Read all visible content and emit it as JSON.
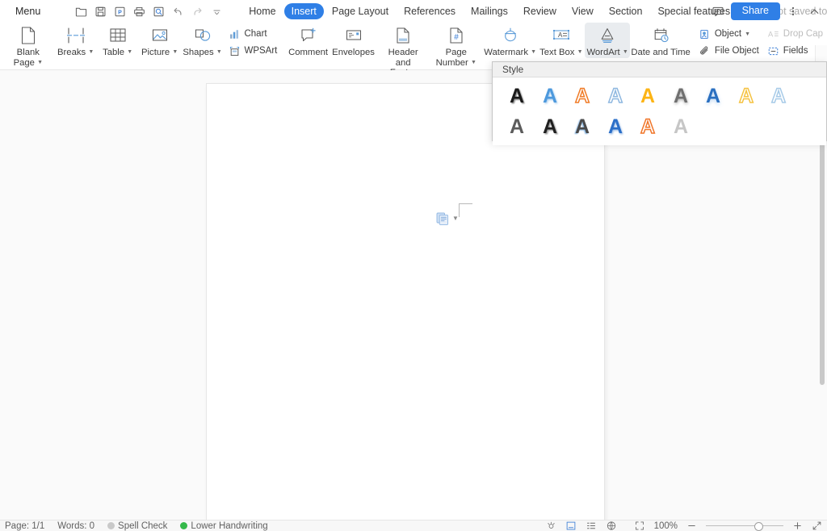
{
  "window": {
    "app": "WPS Writer"
  },
  "topbar": {
    "menu_label": "Menu",
    "quick_access": [
      {
        "name": "open-icon",
        "title": "Open"
      },
      {
        "name": "save-icon",
        "title": "Save"
      },
      {
        "name": "export-pdf-icon",
        "title": "Export to PDF"
      },
      {
        "name": "print-icon",
        "title": "Print"
      },
      {
        "name": "print-preview-icon",
        "title": "Print Preview"
      },
      {
        "name": "undo-icon",
        "title": "Undo"
      },
      {
        "name": "redo-icon",
        "title": "Redo"
      },
      {
        "name": "customize-quick-access-icon",
        "title": "Customize"
      }
    ],
    "tabs": [
      {
        "label": "Home",
        "active": false
      },
      {
        "label": "Insert",
        "active": true
      },
      {
        "label": "Page Layout",
        "active": false
      },
      {
        "label": "References",
        "active": false
      },
      {
        "label": "Mailings",
        "active": false
      },
      {
        "label": "Review",
        "active": false
      },
      {
        "label": "View",
        "active": false
      },
      {
        "label": "Section",
        "active": false
      },
      {
        "label": "Special features",
        "active": false
      }
    ],
    "cloud_status": "Not saved to cloud",
    "share_label": "Share",
    "comment_icon": "comment-icon",
    "more_icon": "more-options-icon",
    "collapse_icon": "collapse-ribbon-icon",
    "accent_color": "#2f7fe6"
  },
  "ribbon": {
    "items": [
      {
        "name": "blank-page",
        "label": "Blank Page",
        "dropdown": true,
        "two_line": true
      },
      {
        "name": "breaks",
        "label": "Breaks",
        "dropdown": true,
        "two_line": false
      },
      {
        "name": "table",
        "label": "Table",
        "dropdown": true,
        "two_line": false
      },
      {
        "name": "picture",
        "label": "Picture",
        "dropdown": true,
        "two_line": false
      },
      {
        "name": "shapes",
        "label": "Shapes",
        "dropdown": true,
        "two_line": false
      },
      {
        "name": "comment",
        "label": "Comment",
        "dropdown": false,
        "two_line": false
      },
      {
        "name": "envelopes",
        "label": "Envelopes",
        "dropdown": false,
        "two_line": false
      },
      {
        "name": "header-and-footer",
        "label": "Header and Footer",
        "dropdown": false,
        "two_line": true
      },
      {
        "name": "page-number",
        "label": "Page Number",
        "dropdown": true,
        "two_line": true
      },
      {
        "name": "watermark",
        "label": "Watermark",
        "dropdown": true,
        "two_line": false
      },
      {
        "name": "text-box",
        "label": "Text Box",
        "dropdown": true,
        "two_line": false
      },
      {
        "name": "wordart",
        "label": "WordArt",
        "dropdown": true,
        "two_line": false,
        "selected": true
      },
      {
        "name": "date-and-time",
        "label": "Date and Time",
        "dropdown": false,
        "two_line": false
      }
    ],
    "small_items": [
      {
        "name": "chart",
        "label": "Chart",
        "dropdown": false,
        "disabled": false
      },
      {
        "name": "wpsart",
        "label": "WPSArt",
        "dropdown": false,
        "disabled": false
      },
      {
        "name": "object",
        "label": "Object",
        "dropdown": true,
        "disabled": false
      },
      {
        "name": "file-object",
        "label": "File Object",
        "dropdown": false,
        "disabled": false
      },
      {
        "name": "drop-cap",
        "label": "Drop Cap",
        "dropdown": false,
        "disabled": true
      },
      {
        "name": "fields",
        "label": "Fields",
        "dropdown": false,
        "disabled": false
      }
    ],
    "expand_label": "›"
  },
  "wordart_panel": {
    "title": "Style",
    "styles": [
      {
        "index": 1,
        "name": "wordart-style-1",
        "fill": "#1a1a1a",
        "stroke": "none",
        "outline": false,
        "shadow": "strong"
      },
      {
        "index": 2,
        "name": "wordart-style-2",
        "fill": "#4d99dd",
        "stroke": "none",
        "outline": false,
        "shadow": "soft"
      },
      {
        "index": 3,
        "name": "wordart-style-3",
        "fill": "none",
        "stroke": "#f07c28",
        "outline": true,
        "shadow": "none"
      },
      {
        "index": 4,
        "name": "wordart-style-4",
        "fill": "none",
        "stroke": "#8fb8e0",
        "outline": true,
        "shadow": "none"
      },
      {
        "index": 5,
        "name": "wordart-style-5",
        "fill": "#fcb415",
        "stroke": "none",
        "outline": false,
        "shadow": "none"
      },
      {
        "index": 6,
        "name": "wordart-style-6",
        "fill": "#6f6f6f",
        "stroke": "none",
        "outline": false,
        "shadow": "blur"
      },
      {
        "index": 7,
        "name": "wordart-style-7",
        "fill": "#2a6fc0",
        "stroke": "none",
        "outline": false,
        "shadow": "glow"
      },
      {
        "index": 8,
        "name": "wordart-style-8",
        "fill": "none",
        "stroke": "#f5c343",
        "outline": true,
        "shadow": "none"
      },
      {
        "index": 9,
        "name": "wordart-style-9",
        "fill": "none",
        "stroke": "#a8cbe8",
        "outline": true,
        "shadow": "none"
      },
      {
        "index": 10,
        "name": "wordart-style-10",
        "fill": "#5c5c5c",
        "stroke": "none",
        "outline": false,
        "shadow": "none"
      },
      {
        "index": 11,
        "name": "wordart-style-11",
        "fill": "#1f1f1f",
        "stroke": "none",
        "outline": false,
        "shadow": "offset"
      },
      {
        "index": 12,
        "name": "wordart-style-12",
        "fill": "#4a4a4a",
        "stroke": "#7fb0e0",
        "outline": false,
        "shadow": "blue-edge"
      },
      {
        "index": 13,
        "name": "wordart-style-13",
        "fill": "#2b6fc8",
        "stroke": "none",
        "outline": false,
        "shadow": "soft"
      },
      {
        "index": 14,
        "name": "wordart-style-14",
        "fill": "none",
        "stroke": "#f0762a",
        "outline": true,
        "shadow": "none"
      },
      {
        "index": 15,
        "name": "wordart-style-15",
        "fill": "#c6c6c6",
        "stroke": "none",
        "outline": false,
        "shadow": "none"
      }
    ],
    "glyph": "A"
  },
  "document": {
    "paste_options_icon": "paste-options-icon",
    "paste_options_dropdown": "chevron-down-icon",
    "margin_mark": "margin-corner-mark"
  },
  "statusbar": {
    "page_info": "Page: 1/1",
    "word_count": "Words: 0",
    "spell_check": "Spell Check",
    "handwriting": "Lower Handwriting",
    "spell_dot_color": "#bdbdbd",
    "handwriting_dot_color": "#35b94a",
    "view_icons": [
      {
        "name": "night-mode-icon"
      },
      {
        "name": "print-layout-view-icon",
        "active": true
      },
      {
        "name": "outline-view-icon"
      },
      {
        "name": "web-layout-view-icon"
      },
      {
        "name": "reading-layout-icon"
      }
    ],
    "zoom_level": "100%",
    "zoom_out_icon": "zoom-out-icon",
    "zoom_in_icon": "zoom-in-icon",
    "fullscreen_icon": "fullscreen-icon"
  }
}
